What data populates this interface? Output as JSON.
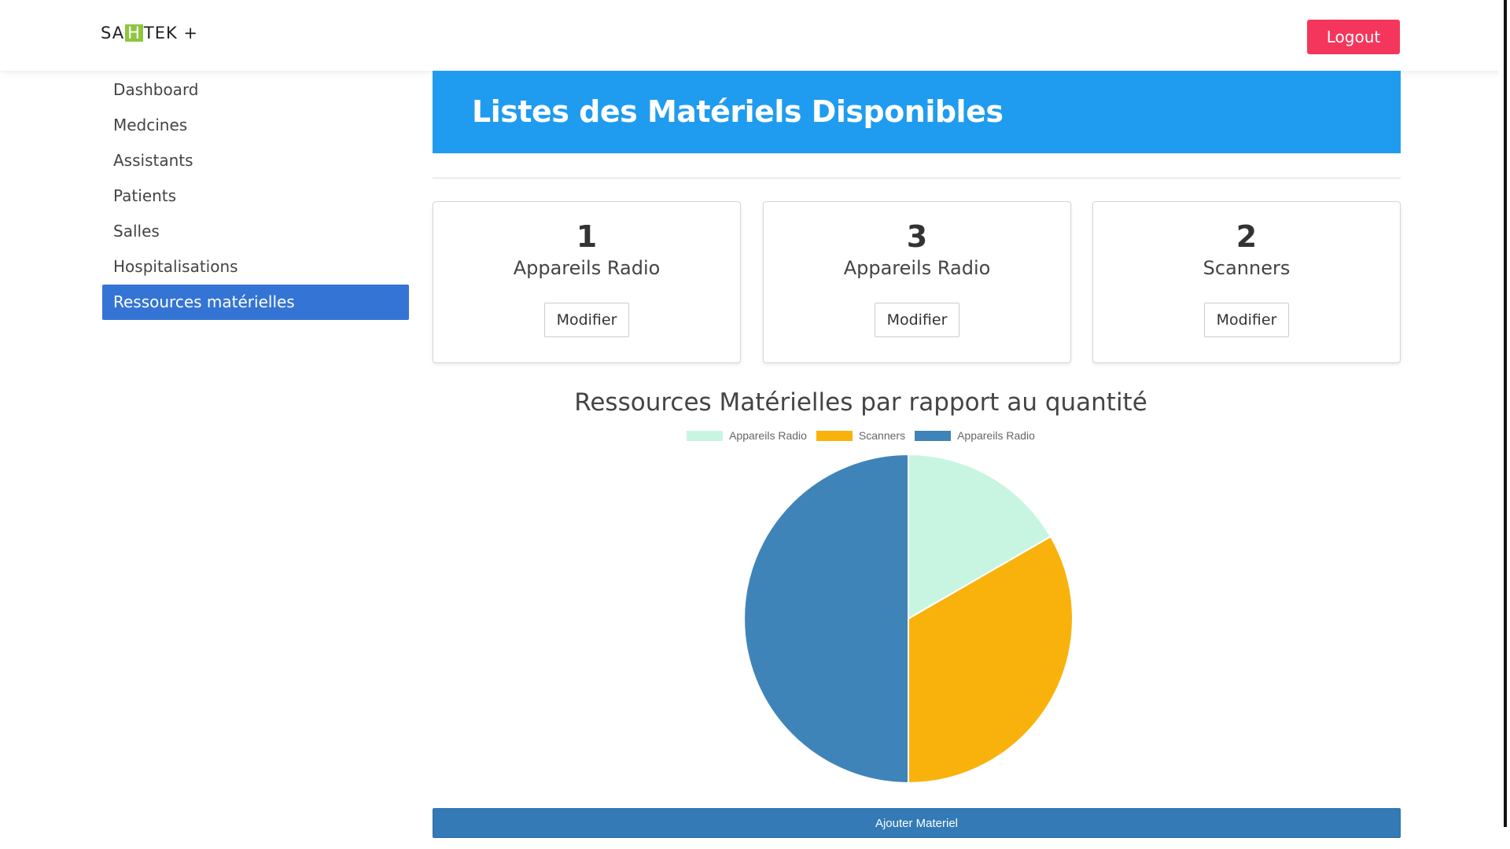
{
  "brand": {
    "prefix": "SA",
    "highlight": "H",
    "suffix": "TEK +"
  },
  "header": {
    "logout_label": "Logout"
  },
  "sidebar": {
    "items": [
      {
        "label": "Dashboard"
      },
      {
        "label": "Medcines"
      },
      {
        "label": "Assistants"
      },
      {
        "label": "Patients"
      },
      {
        "label": "Salles"
      },
      {
        "label": "Hospitalisations"
      },
      {
        "label": "Ressources matérielles",
        "active": true
      }
    ]
  },
  "banner": {
    "title": "Listes des Matériels Disponibles"
  },
  "cards": [
    {
      "count": "1",
      "label": "Appareils Radio",
      "button": "Modifier"
    },
    {
      "count": "3",
      "label": "Appareils Radio",
      "button": "Modifier"
    },
    {
      "count": "2",
      "label": "Scanners",
      "button": "Modifier"
    }
  ],
  "chart_data": {
    "type": "pie",
    "title": "Ressources Matérielles par rapport au quantité",
    "legend_position": "top",
    "categories": [
      "Appareils Radio",
      "Scanners",
      "Appareils Radio"
    ],
    "values": [
      1,
      2,
      3
    ],
    "colors": [
      "#c8f5e2",
      "#f9b20c",
      "#3f84b8"
    ]
  },
  "footer": {
    "add_label": "Ajouter Materiel"
  },
  "colors": {
    "banner": "#1f9cef",
    "logout": "#f5365c",
    "sidebar_active": "#3474d4",
    "add_button": "#337ab7"
  }
}
